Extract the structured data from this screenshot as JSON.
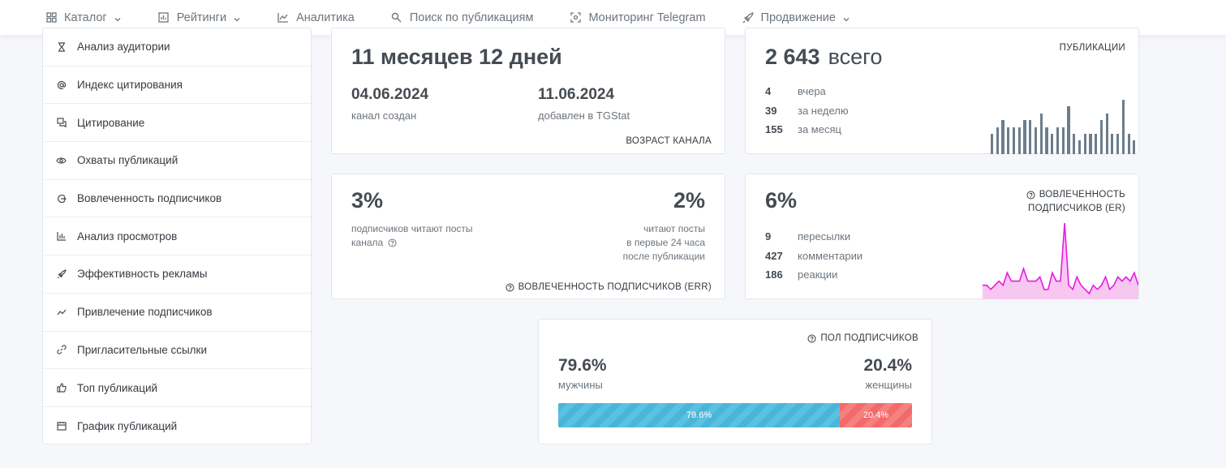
{
  "nav": [
    {
      "label": "Каталог",
      "icon": "grid-icon",
      "chevron": true
    },
    {
      "label": "Рейтинги",
      "icon": "bar-chart-icon",
      "chevron": true
    },
    {
      "label": "Аналитика",
      "icon": "line-chart-icon",
      "chevron": false
    },
    {
      "label": "Поиск по публикациям",
      "icon": "search-icon",
      "chevron": false
    },
    {
      "label": "Мониторинг Telegram",
      "icon": "scan-icon",
      "chevron": false
    },
    {
      "label": "Продвижение",
      "icon": "rocket-icon",
      "chevron": true
    }
  ],
  "sidebar": {
    "items": [
      {
        "label": "Анализ аудитории",
        "icon": "hourglass-icon"
      },
      {
        "label": "Индекс цитирования",
        "icon": "at-icon"
      },
      {
        "label": "Цитирование",
        "icon": "quote-chat-icon"
      },
      {
        "label": "Охваты публикаций",
        "icon": "eye-icon"
      },
      {
        "label": "Вовлеченность подписчиков",
        "icon": "engagement-icon"
      },
      {
        "label": "Анализ просмотров",
        "icon": "bar-chart-icon"
      },
      {
        "label": "Эффективность рекламы",
        "icon": "rocket-icon"
      },
      {
        "label": "Привлечение подписчиков",
        "icon": "trend-icon"
      },
      {
        "label": "Пригласительные ссылки",
        "icon": "link-icon"
      },
      {
        "label": "Топ публикаций",
        "icon": "thumbs-up-icon"
      },
      {
        "label": "График публикаций",
        "icon": "calendar-icon"
      }
    ]
  },
  "age": {
    "value": "11 месяцев 12 дней",
    "created_date": "04.06.2024",
    "created_label": "канал создан",
    "added_date": "11.06.2024",
    "added_label": "добавлен в TGStat",
    "caption": "ВОЗРАСТ КАНАЛА"
  },
  "posts": {
    "total_num": "2 643",
    "total_word": "всего",
    "caption": "ПУБЛИКАЦИИ",
    "stats": [
      {
        "num": "4",
        "label": "вчера"
      },
      {
        "num": "39",
        "label": "за неделю"
      },
      {
        "num": "155",
        "label": "за месяц"
      }
    ],
    "bars": [
      3,
      4,
      5,
      4,
      4,
      4,
      5,
      5,
      4,
      6,
      4,
      3,
      4,
      4,
      7,
      3,
      2,
      3,
      3,
      3,
      5,
      6,
      3,
      3,
      8,
      3,
      2
    ]
  },
  "err": {
    "left_value": "3%",
    "left_label_1": "подписчиков читают посты",
    "left_label_2": "канала",
    "right_value": "2%",
    "right_label_1": "читают посты",
    "right_label_2": "в первые 24 часа",
    "right_label_3": "после публикации",
    "caption": "ВОВЛЕЧЕННОСТЬ ПОДПИСЧИКОВ (ERR)"
  },
  "er": {
    "value": "6%",
    "caption_1": "ВОВЛЕЧЕННОСТЬ",
    "caption_2": "ПОДПИСЧИКОВ (ER)",
    "stats": [
      {
        "num": "9",
        "label": "пересылки"
      },
      {
        "num": "427",
        "label": "комментарии"
      },
      {
        "num": "186",
        "label": "реакции"
      }
    ],
    "series": [
      3,
      3,
      2,
      3,
      4,
      3,
      6,
      4,
      4,
      4,
      7,
      4,
      4,
      4,
      5,
      2,
      2,
      6,
      4,
      4,
      18,
      3,
      2,
      5,
      3,
      2,
      1,
      3,
      2,
      3,
      5,
      2,
      3,
      5,
      4,
      5,
      4,
      6,
      3
    ]
  },
  "gender": {
    "caption": "ПОЛ ПОДПИСЧИКОВ",
    "male_value": "79.6%",
    "male_label": "мужчины",
    "female_value": "20.4%",
    "female_label": "женщины",
    "male_fraction": 0.796,
    "bar_male": "79.6%",
    "bar_female": "20.4%"
  }
}
